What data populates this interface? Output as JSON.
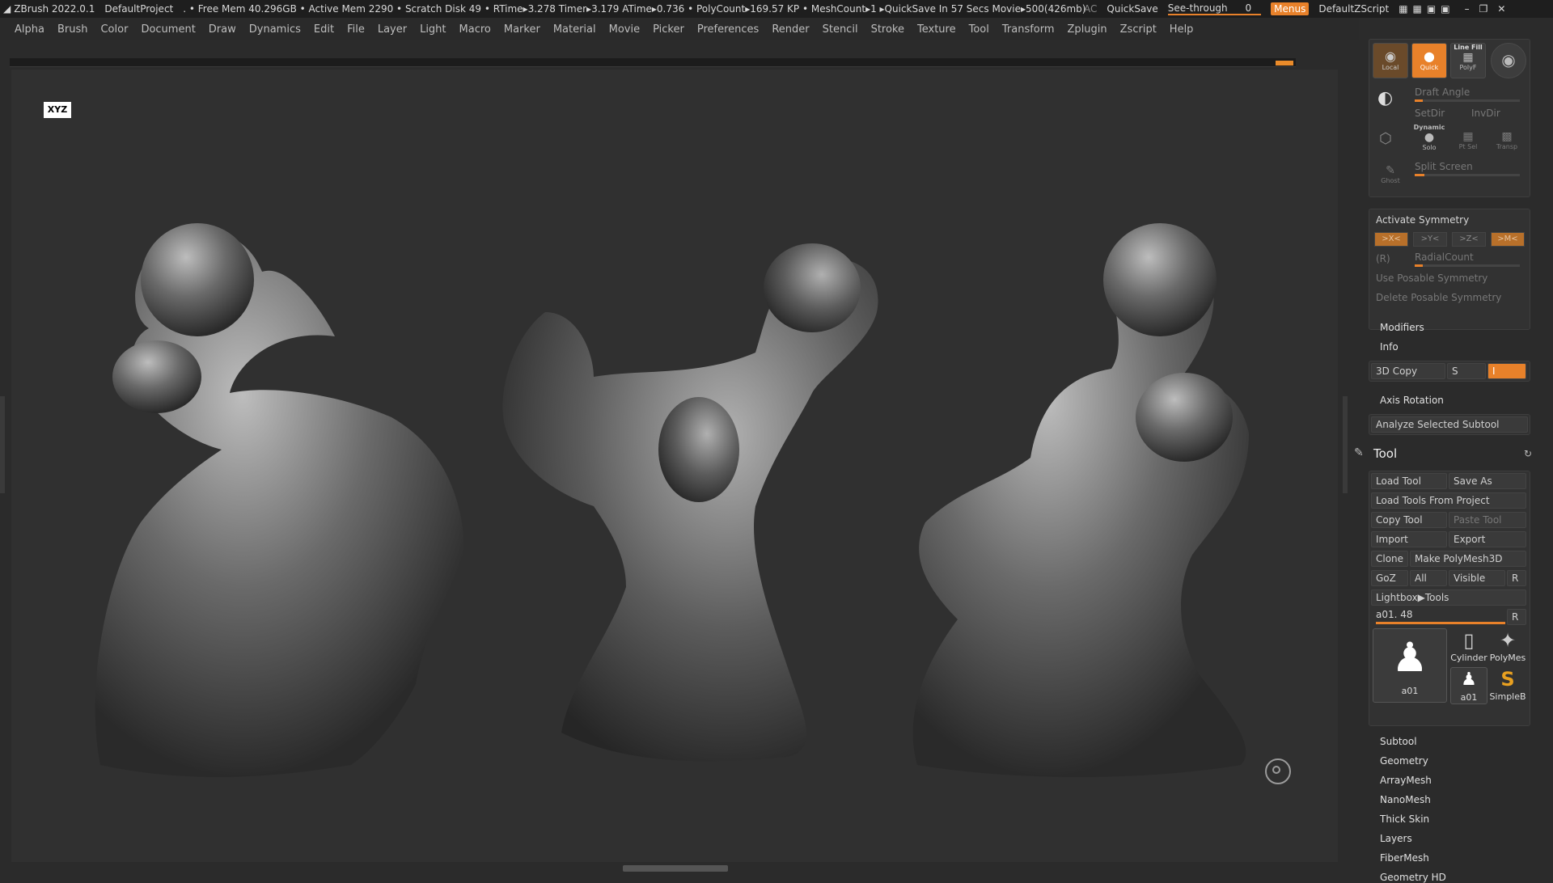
{
  "titlebar": {
    "app": "ZBrush 2022.0.1",
    "project": "DefaultProject",
    "stats": ". • Free Mem 40.296GB • Active Mem 2290 • Scratch Disk 49 • RTime▸3.278 Timer▸3.179 ATime▸0.736 • PolyCount▸169.57 KP • MeshCount▸1 ▸QuickSave In 57 Secs Movie▸500(426mb)",
    "ac": "AC",
    "quicksave": "QuickSave",
    "seethrough": "See-through",
    "seethrough_value": "0",
    "menus": "Menus",
    "script": "DefaultZScript"
  },
  "menu": [
    "Alpha",
    "Brush",
    "Color",
    "Document",
    "Draw",
    "Dynamics",
    "Edit",
    "File",
    "Layer",
    "Light",
    "Macro",
    "Marker",
    "Material",
    "Movie",
    "Picker",
    "Preferences",
    "Render",
    "Stencil",
    "Stroke",
    "Texture",
    "Tool",
    "Transform",
    "Zplugin",
    "Zscript",
    "Help"
  ],
  "viewport": {
    "logo": "XYZ"
  },
  "panel": {
    "top_icons": {
      "local": "Local",
      "quick": "Quick",
      "linefill": "Line Fill",
      "polyf": "PolyF",
      "dynamic": "Dynamic",
      "solo": "Solo",
      "xpose": "Pt Sel",
      "transp": "Transp",
      "ghost": "Ghost"
    },
    "draft_angle": "Draft Angle",
    "setdir": "SetDir",
    "invdir": "InvDir",
    "split_screen": "Split Screen",
    "activate_symmetry": "Activate Symmetry",
    "sym_x": ">X<",
    "sym_y": ">Y<",
    "sym_z": ">Z<",
    "sym_m": ">M<",
    "sym_r": "(R)",
    "radial_count": "RadialCount",
    "use_posable": "Use Posable Symmetry",
    "delete_posable": "Delete Posable Symmetry",
    "modifiers": "Modifiers",
    "info": "Info",
    "copy3d": "3D Copy",
    "copy_s": "S",
    "copy_val": "I",
    "axis_rotation": "Axis Rotation",
    "analyze": "Analyze Selected Subtool",
    "tool_title": "Tool",
    "load_tool": "Load Tool",
    "save_as": "Save As",
    "load_from_project": "Load Tools From Project",
    "copy_tool": "Copy Tool",
    "paste_tool": "Paste Tool",
    "import": "Import",
    "export": "Export",
    "clone": "Clone",
    "make_polymesh": "Make PolyMesh3D",
    "goz": "GoZ",
    "all": "All",
    "visible": "Visible",
    "r": "R",
    "lightbox_tools": "Lightbox▶Tools",
    "current_tool": "a01. 48",
    "current_r": "R",
    "thumbs": {
      "main": "a01",
      "cylinder": "Cylinder",
      "polymesh": "PolyMes",
      "small": "a01",
      "simple": "SimpleB"
    },
    "sections": [
      "Subtool",
      "Geometry",
      "ArrayMesh",
      "NanoMesh",
      "Thick Skin",
      "Layers",
      "FiberMesh",
      "Geometry HD"
    ]
  }
}
